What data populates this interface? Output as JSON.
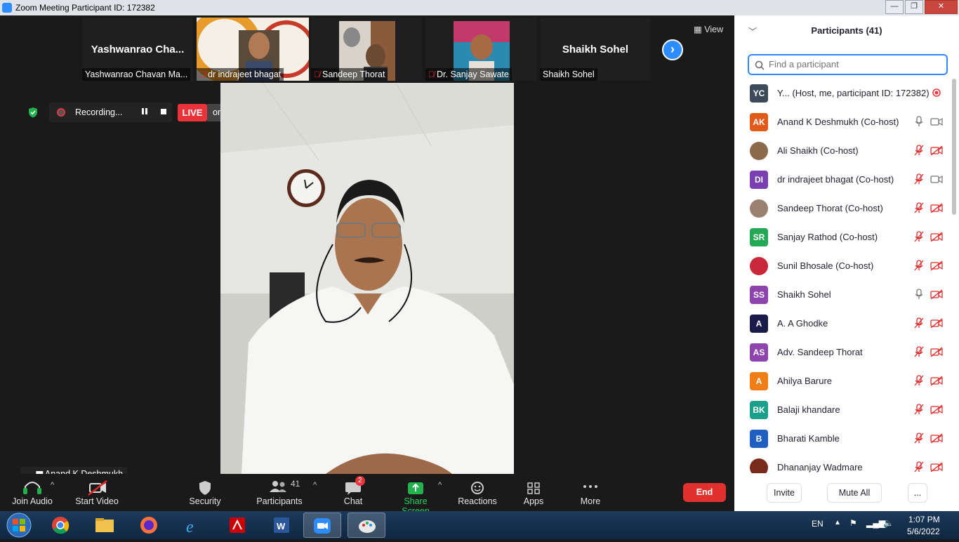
{
  "window": {
    "title": "Zoom Meeting Participant ID: 172382",
    "minimize": "—",
    "maximize": "❐",
    "close": "✕"
  },
  "gallery": {
    "tiles": [
      {
        "big_name": "Yashwanrao  Cha...",
        "label": "Yashwanrao Chavan Ma..."
      },
      {
        "label": "dr indrajeet bhagat"
      },
      {
        "label": "Sandeep Thorat"
      },
      {
        "label": "Dr. Sanjay Sawate"
      },
      {
        "big_name": "Shaikh Sohel",
        "label": "Shaikh Sohel"
      }
    ],
    "view_label": "View"
  },
  "recording": {
    "label": "Recording...",
    "live": "LIVE",
    "destination": "on YouTube"
  },
  "speaker": {
    "name": "Anand K Deshmukh"
  },
  "toolbar": {
    "join_audio": "Join Audio",
    "start_video": "Start Video",
    "security": "Security",
    "participants": "Participants",
    "participants_count": "41",
    "chat": "Chat",
    "chat_badge": "2",
    "share_screen": "Share Screen",
    "reactions": "Reactions",
    "apps": "Apps",
    "more": "More",
    "end": "End"
  },
  "panel": {
    "title": "Participants (41)",
    "search_placeholder": "Find a participant",
    "participants": [
      {
        "initials": "YC",
        "name": "Y... (Host, me, participant ID: 172382)",
        "color": "#3c4a5a",
        "mic": "recording",
        "cam": "none"
      },
      {
        "initials": "AK",
        "name": "Anand K Deshmukh (Co-host)",
        "color": "#e05a1a",
        "mic": "on",
        "cam": "on"
      },
      {
        "initials": "",
        "name": "Ali Shaikh (Co-host)",
        "color": "#8a6a4a",
        "mic": "off",
        "cam": "off"
      },
      {
        "initials": "DI",
        "name": "dr indrajeet bhagat (Co-host)",
        "color": "#7a3fb0",
        "mic": "off",
        "cam": "on"
      },
      {
        "initials": "",
        "name": "Sandeep Thorat (Co-host)",
        "color": "#9a8070",
        "mic": "off",
        "cam": "off"
      },
      {
        "initials": "SR",
        "name": "Sanjay Rathod (Co-host)",
        "color": "#25a855",
        "mic": "off",
        "cam": "off"
      },
      {
        "initials": "",
        "name": "Sunil Bhosale (Co-host)",
        "color": "#c8283a",
        "mic": "off",
        "cam": "off"
      },
      {
        "initials": "SS",
        "name": "Shaikh Sohel",
        "color": "#8e44ad",
        "mic": "on",
        "cam": "off"
      },
      {
        "initials": "A",
        "name": "A. A Ghodke",
        "color": "#1b1b4a",
        "mic": "off",
        "cam": "off"
      },
      {
        "initials": "AS",
        "name": "Adv. Sandeep Thorat",
        "color": "#8e44ad",
        "mic": "off",
        "cam": "off"
      },
      {
        "initials": "A",
        "name": "Ahilya Barure",
        "color": "#f07e16",
        "mic": "off",
        "cam": "off"
      },
      {
        "initials": "BK",
        "name": "Balaji khandare",
        "color": "#1aa08a",
        "mic": "off",
        "cam": "off"
      },
      {
        "initials": "B",
        "name": "Bharati Kamble",
        "color": "#1f5fbf",
        "mic": "off",
        "cam": "off"
      },
      {
        "initials": "",
        "name": "Dhananjay Wadmare",
        "color": "#7a2a1a",
        "mic": "off",
        "cam": "off"
      }
    ],
    "invite": "Invite",
    "mute_all": "Mute All",
    "more": "..."
  },
  "taskbar": {
    "lang": "EN",
    "time": "1:07 PM",
    "date": "5/6/2022"
  }
}
